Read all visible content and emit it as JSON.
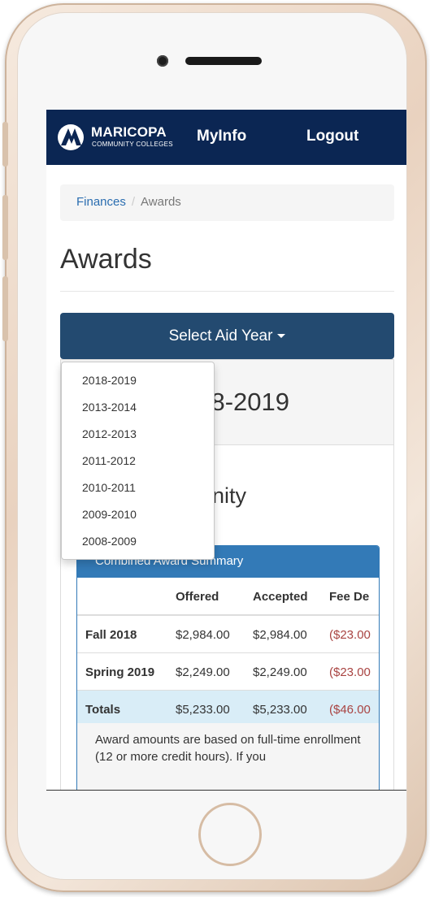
{
  "logo": {
    "title": "MARICOPA",
    "subtitle": "COMMUNITY COLLEGES"
  },
  "nav": {
    "myinfo": "MyInfo",
    "logout": "Logout"
  },
  "breadcrumb": {
    "finances": "Finances",
    "separator": "/",
    "current": "Awards"
  },
  "page": {
    "title": "Awards"
  },
  "select_aid_year": {
    "label": "Select Aid Year"
  },
  "dropdown": {
    "items": [
      "2018-2019",
      "2013-2014",
      "2012-2013",
      "2011-2012",
      "2010-2011",
      "2009-2010",
      "2008-2009"
    ]
  },
  "year_panel": {
    "heading": "018-2019",
    "college_partial": "mmunity"
  },
  "summary": {
    "title": "Combined Award Summary",
    "columns": [
      "",
      "Offered",
      "Accepted",
      "Fee De"
    ],
    "rows": [
      {
        "term": "Fall 2018",
        "offered": "$2,984.00",
        "accepted": "$2,984.00",
        "fee": "($23.00"
      },
      {
        "term": "Spring 2019",
        "offered": "$2,249.00",
        "accepted": "$2,249.00",
        "fee": "($23.00"
      }
    ],
    "totals": {
      "label": "Totals",
      "offered": "$5,233.00",
      "accepted": "$5,233.00",
      "fee": "($46.00"
    },
    "note": "Award amounts are based on full-time enrollment (12 or more credit hours). If you"
  },
  "colors": {
    "navbar": "#0b2653",
    "select_button": "#234a70",
    "panel_header": "#337ab7",
    "fee_red": "#a94442",
    "totals_bg": "#d9edf7"
  }
}
